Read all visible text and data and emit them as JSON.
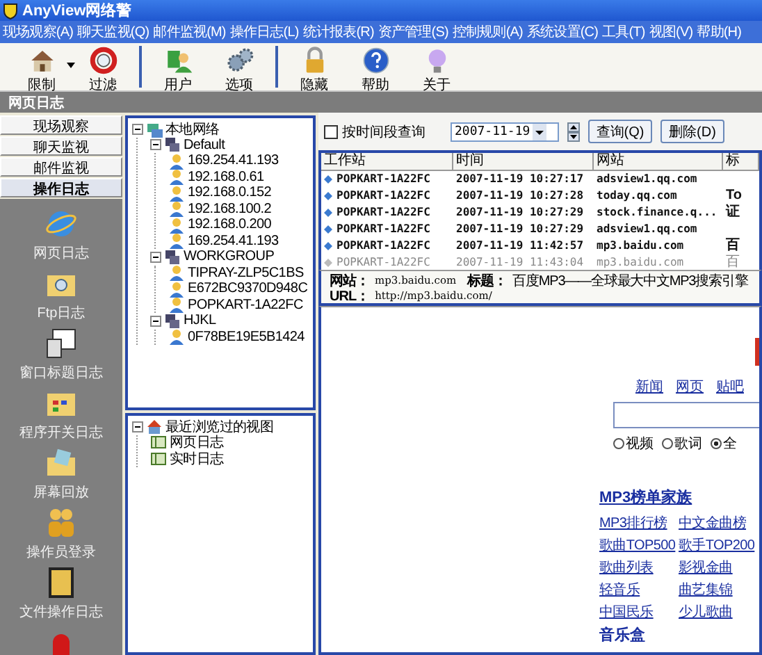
{
  "window": {
    "title": "AnyView网络警"
  },
  "menu": [
    "现场观察(A)",
    "聊天监视(Q)",
    "邮件监视(M)",
    "操作日志(L)",
    "统计报表(R)",
    "资产管理(S)",
    "控制规则(A)",
    "系统设置(C)",
    "工具(T)",
    "视图(V)",
    "帮助(H)"
  ],
  "toolbar": [
    [
      {
        "label": "限制",
        "dropdown": true
      },
      {
        "label": "过滤",
        "dropdown": false
      }
    ],
    [
      {
        "label": "用户",
        "dropdown": false
      },
      {
        "label": "选项",
        "dropdown": false
      }
    ],
    [
      {
        "label": "隐藏",
        "dropdown": false
      },
      {
        "label": "帮助",
        "dropdown": false
      },
      {
        "label": "关于",
        "dropdown": false
      }
    ]
  ],
  "section_title": "网页日志",
  "nav_tabs": [
    {
      "label": "现场观察",
      "selected": false
    },
    {
      "label": "聊天监视",
      "selected": false
    },
    {
      "label": "邮件监视",
      "selected": false
    },
    {
      "label": "操作日志",
      "selected": true
    }
  ],
  "log_types": [
    "网页日志",
    "Ftp日志",
    "窗口标题日志",
    "程序开关日志",
    "屏幕回放",
    "操作员登录",
    "文件操作日志"
  ],
  "network_tree": [
    {
      "label": "本地网络",
      "kind": "network",
      "expanded": true,
      "children": [
        {
          "label": "Default",
          "kind": "group",
          "expanded": true,
          "children": [
            {
              "label": "169.254.41.193",
              "kind": "host"
            },
            {
              "label": "192.168.0.61",
              "kind": "host"
            },
            {
              "label": "192.168.0.152",
              "kind": "host"
            },
            {
              "label": "192.168.100.2",
              "kind": "host"
            },
            {
              "label": "192.168.0.200",
              "kind": "host"
            },
            {
              "label": "169.254.41.193",
              "kind": "host"
            }
          ]
        },
        {
          "label": "WORKGROUP",
          "kind": "group",
          "expanded": true,
          "children": [
            {
              "label": "TIPRAY-ZLP5C1BS",
              "kind": "host"
            },
            {
              "label": "E672BC9370D948C",
              "kind": "host"
            },
            {
              "label": "POPKART-1A22FC",
              "kind": "host"
            }
          ]
        },
        {
          "label": "HJKL",
          "kind": "group",
          "expanded": true,
          "children": [
            {
              "label": "0F78BE19E5B1424",
              "kind": "host"
            }
          ]
        }
      ]
    }
  ],
  "recent_views": [
    {
      "label": "最近浏览过的视图",
      "kind": "home",
      "expanded": true,
      "children": [
        {
          "label": "网页日志",
          "kind": "view"
        },
        {
          "label": "实时日志",
          "kind": "view"
        }
      ]
    }
  ],
  "query": {
    "checkbox": {
      "label": "按时间段查询",
      "checked": false
    },
    "date": "2007-11-19",
    "buttons": [
      "查询(Q)",
      "删除(D)"
    ]
  },
  "table": {
    "columns": [
      "工作站",
      "时间",
      "网站",
      "标"
    ],
    "rows": [
      {
        "workstation": "POPKART-1A22FC",
        "time": "2007-11-19 10:27:17",
        "site": "adsview1.qq.com",
        "dimmed": false
      },
      {
        "workstation": "POPKART-1A22FC",
        "time": "2007-11-19 10:27:28",
        "site": "today.qq.com",
        "column_4": "To",
        "dimmed": false
      },
      {
        "workstation": "POPKART-1A22FC",
        "time": "2007-11-19 10:27:29",
        "site": "stock.finance.q...",
        "column_4": "证",
        "dimmed": false
      },
      {
        "workstation": "POPKART-1A22FC",
        "time": "2007-11-19 10:27:29",
        "site": "adsview1.qq.com",
        "dimmed": false
      },
      {
        "workstation": "POPKART-1A22FC",
        "time": "2007-11-19 11:42:57",
        "site": "mp3.baidu.com",
        "column_4": "百",
        "dimmed": false
      },
      {
        "workstation": "POPKART-1A22FC",
        "time": "2007-11-19 11:43:04",
        "site": "mp3.baidu.com",
        "column_4": "百",
        "dimmed": true
      }
    ]
  },
  "detail": {
    "site_label": "网站：",
    "site": "mp3.baidu.com",
    "title_label": "标题：",
    "title": "百度MP3——全球最大中文MP3搜索引擎",
    "url_label": "URL：",
    "url": "http://mp3.baidu.com/"
  },
  "browser": {
    "nav_links": [
      "新闻",
      "网页",
      "贴吧"
    ],
    "radios": [
      {
        "label": "视频",
        "selected": false
      },
      {
        "label": "歌词",
        "selected": false
      },
      {
        "label": "全",
        "selected": true
      }
    ],
    "heading": "MP3榜单家族",
    "links": [
      "MP3排行榜",
      "中文金曲榜",
      "歌曲TOP500",
      "歌手TOP200",
      "歌曲列表",
      "影视金曲",
      "轻音乐",
      "曲艺集锦",
      "中国民乐",
      "少儿歌曲"
    ],
    "next_heading": "音乐盒"
  }
}
